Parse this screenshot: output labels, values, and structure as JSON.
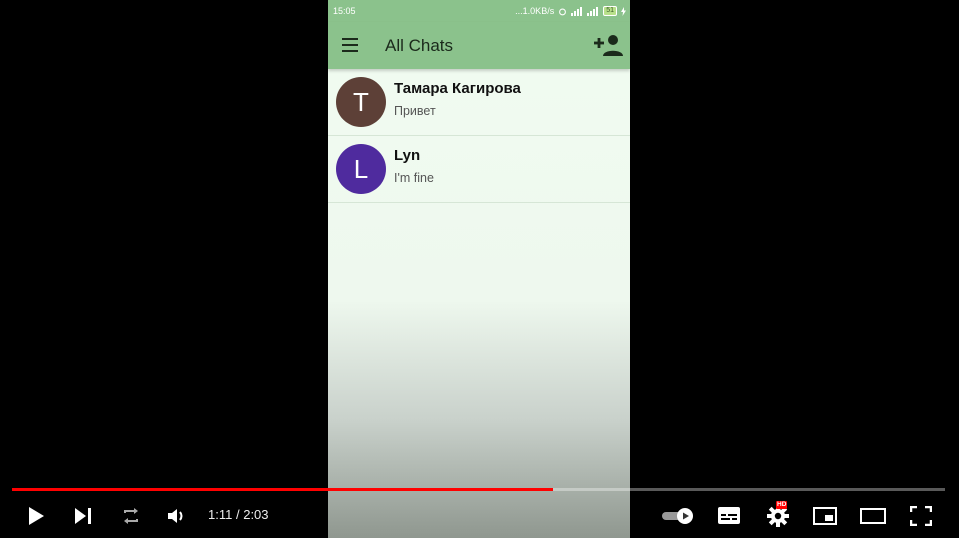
{
  "phone": {
    "status_bar": {
      "time": "15:05",
      "network_speed": "...1.0KB/s",
      "battery": "51"
    },
    "app_bar": {
      "title": "All Chats"
    },
    "chats": [
      {
        "initial": "T",
        "name": "Тамара Кагирова",
        "preview": "Привет",
        "avatar_color": "#5d4037"
      },
      {
        "initial": "L",
        "name": "Lyn",
        "preview": "I'm fine",
        "avatar_color": "#4f2b9e"
      }
    ]
  },
  "player": {
    "current_time": "1:11",
    "separator": "/",
    "duration": "2:03",
    "progress_fraction": 0.58,
    "quality_badge": "HD",
    "progress_color": "#ff0000",
    "icons": [
      "play-icon",
      "next-icon",
      "loop-icon",
      "volume-icon",
      "autoplay-toggle-icon",
      "subtitles-icon",
      "settings-icon",
      "miniplayer-icon",
      "theater-icon",
      "fullscreen-icon"
    ]
  }
}
